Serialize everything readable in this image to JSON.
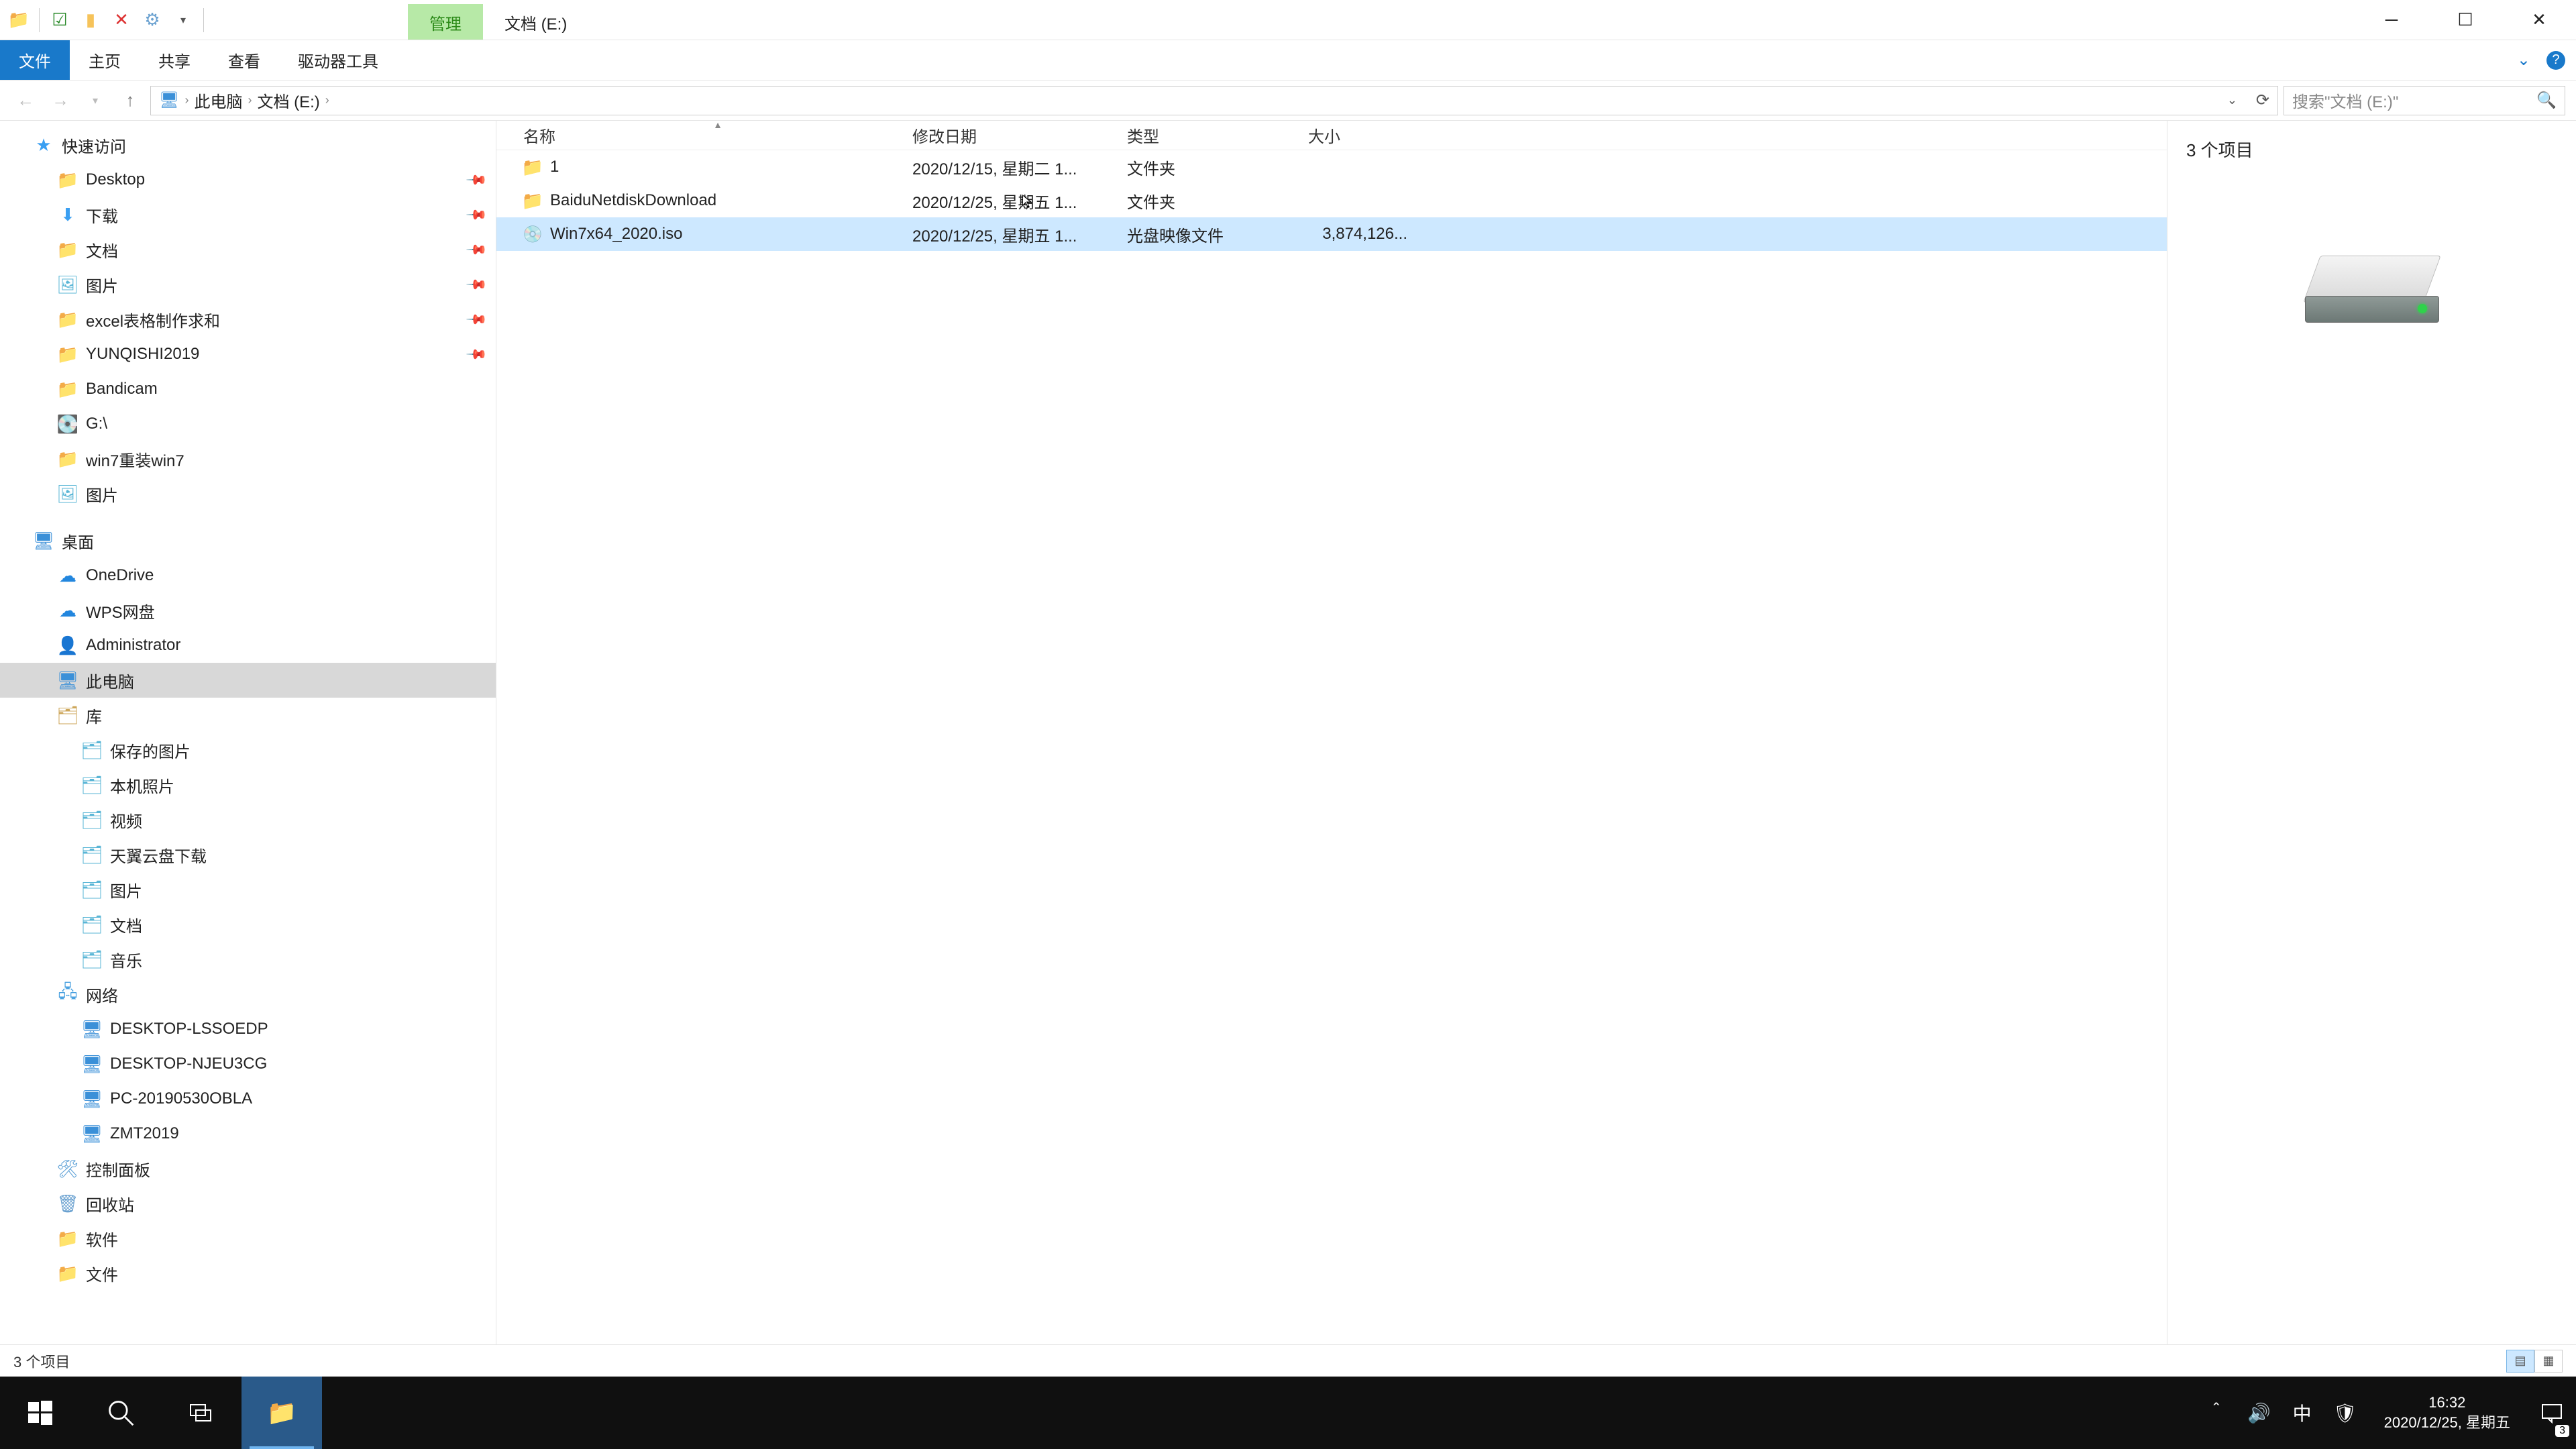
{
  "titlebar": {
    "context_tab": "管理",
    "path_tab": "文档 (E:)"
  },
  "ribbon": {
    "file": "文件",
    "home": "主页",
    "share": "共享",
    "view": "查看",
    "drive_tools": "驱动器工具"
  },
  "address": {
    "crumbs": [
      "此电脑",
      "文档 (E:)"
    ]
  },
  "search": {
    "placeholder": "搜索\"文档 (E:)\""
  },
  "tree": {
    "quick_access": "快速访问",
    "pinned": [
      {
        "label": "Desktop",
        "icon": "folder"
      },
      {
        "label": "下载",
        "icon": "down"
      },
      {
        "label": "文档",
        "icon": "folder"
      },
      {
        "label": "图片",
        "icon": "pic"
      },
      {
        "label": "excel表格制作求和",
        "icon": "folder"
      },
      {
        "label": "YUNQISHI2019",
        "icon": "folder"
      },
      {
        "label": "Bandicam",
        "icon": "folder"
      },
      {
        "label": "G:\\",
        "icon": "drive"
      },
      {
        "label": "win7重装win7",
        "icon": "folder"
      },
      {
        "label": "图片",
        "icon": "pic"
      }
    ],
    "desktop": "桌面",
    "onedrive": "OneDrive",
    "wps": "WPS网盘",
    "admin": "Administrator",
    "this_pc": "此电脑",
    "libraries": "库",
    "lib_items": [
      {
        "label": "保存的图片"
      },
      {
        "label": "本机照片"
      },
      {
        "label": "视频"
      },
      {
        "label": "天翼云盘下载"
      },
      {
        "label": "图片"
      },
      {
        "label": "文档"
      },
      {
        "label": "音乐"
      }
    ],
    "network": "网络",
    "net_items": [
      "DESKTOP-LSSOEDP",
      "DESKTOP-NJEU3CG",
      "PC-20190530OBLA",
      "ZMT2019"
    ],
    "control_panel": "控制面板",
    "recycle": "回收站",
    "software": "软件",
    "files": "文件"
  },
  "columns": {
    "name": "名称",
    "date": "修改日期",
    "type": "类型",
    "size": "大小"
  },
  "rows": [
    {
      "name": "1",
      "date": "2020/12/15, 星期二 1...",
      "type": "文件夹",
      "size": "",
      "icon": "folder",
      "sel": false
    },
    {
      "name": "BaiduNetdiskDownload",
      "date": "2020/12/25, 星期五 1...",
      "type": "文件夹",
      "size": "",
      "icon": "folder",
      "sel": false
    },
    {
      "name": "Win7x64_2020.iso",
      "date": "2020/12/25, 星期五 1...",
      "type": "光盘映像文件",
      "size": "3,874,126...",
      "icon": "iso",
      "sel": true
    }
  ],
  "preview": {
    "summary": "3 个项目"
  },
  "status": {
    "text": "3 个项目"
  },
  "systray": {
    "ime": "中",
    "time": "16:32",
    "date": "2020/12/25, 星期五",
    "notif_count": "3"
  }
}
